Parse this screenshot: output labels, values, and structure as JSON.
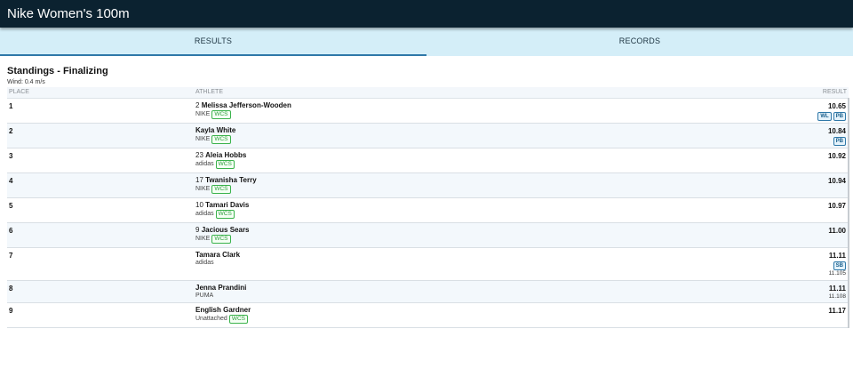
{
  "header": {
    "title": "Nike Women's 100m"
  },
  "tabs": [
    {
      "label": "RESULTS",
      "active": true
    },
    {
      "label": "RECORDS",
      "active": false
    }
  ],
  "standings": {
    "title": "Standings - Finalizing",
    "wind": "Wind: 0.4 m/s"
  },
  "columns": {
    "place": "PLACE",
    "athlete": "ATHLETE",
    "result": "RESULT"
  },
  "colors": {
    "topbar": "#0b2230",
    "tabs_bg": "#d4eef8",
    "tab_active": "#2f78a8",
    "wcs": "#3bb34c",
    "badge": "#2f78a8"
  },
  "rows": [
    {
      "place": "1",
      "bib": "2",
      "name": "Melissa Jefferson-Wooden",
      "team": "NIKE",
      "wcs": "WCS",
      "mark": "10.65",
      "badges": [
        "WL",
        "PB"
      ],
      "sub": ""
    },
    {
      "place": "2",
      "bib": "",
      "name": "Kayla White",
      "team": "NIKE",
      "wcs": "WCS",
      "mark": "10.84",
      "badges": [
        "PB"
      ],
      "sub": ""
    },
    {
      "place": "3",
      "bib": "23",
      "name": "Aleia Hobbs",
      "team": "adidas",
      "wcs": "WCS",
      "mark": "10.92",
      "badges": [],
      "sub": ""
    },
    {
      "place": "4",
      "bib": "17",
      "name": "Twanisha Terry",
      "team": "NIKE",
      "wcs": "WCS",
      "mark": "10.94",
      "badges": [],
      "sub": ""
    },
    {
      "place": "5",
      "bib": "10",
      "name": "Tamari Davis",
      "team": "adidas",
      "wcs": "WCS",
      "mark": "10.97",
      "badges": [],
      "sub": ""
    },
    {
      "place": "6",
      "bib": "9",
      "name": "Jacious Sears",
      "team": "NIKE",
      "wcs": "WCS",
      "mark": "11.00",
      "badges": [],
      "sub": ""
    },
    {
      "place": "7",
      "bib": "",
      "name": "Tamara Clark",
      "team": "adidas",
      "wcs": "",
      "mark": "11.11",
      "badges": [
        "SB"
      ],
      "sub": "11.105"
    },
    {
      "place": "8",
      "bib": "",
      "name": "Jenna Prandini",
      "team": "PUMA",
      "wcs": "",
      "mark": "11.11",
      "badges": [],
      "sub": "11.108"
    },
    {
      "place": "9",
      "bib": "",
      "name": "English Gardner",
      "team": "Unattached",
      "wcs": "WCS",
      "mark": "11.17",
      "badges": [],
      "sub": ""
    }
  ]
}
